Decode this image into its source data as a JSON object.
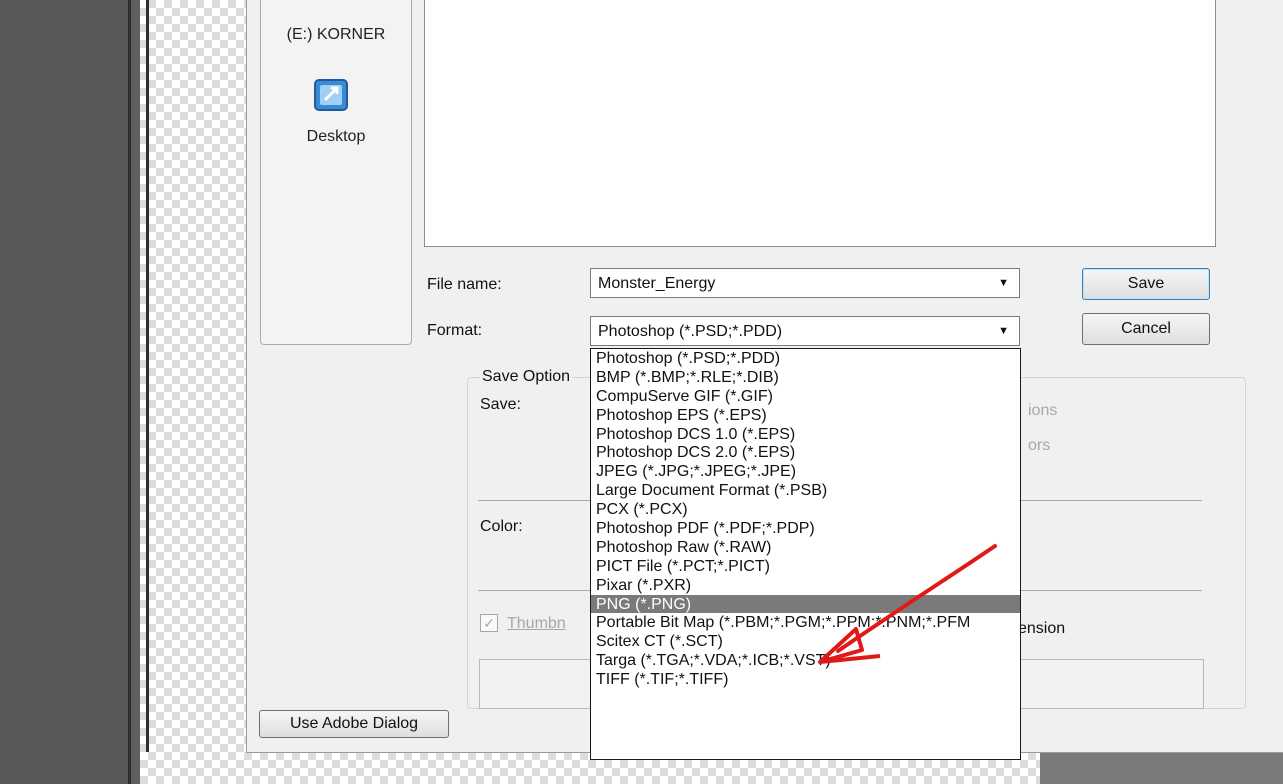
{
  "places": {
    "drive_label": "(E:) KORNER",
    "desktop_label": "Desktop"
  },
  "file_name": {
    "label": "File name:",
    "value": "Monster_Energy"
  },
  "format": {
    "label": "Format:",
    "value": "Photoshop (*.PSD;*.PDD)",
    "options": [
      "Photoshop (*.PSD;*.PDD)",
      "BMP (*.BMP;*.RLE;*.DIB)",
      "CompuServe GIF (*.GIF)",
      "Photoshop EPS (*.EPS)",
      "Photoshop DCS 1.0 (*.EPS)",
      "Photoshop DCS 2.0 (*.EPS)",
      "JPEG (*.JPG;*.JPEG;*.JPE)",
      "Large Document Format (*.PSB)",
      "PCX (*.PCX)",
      "Photoshop PDF (*.PDF;*.PDP)",
      "Photoshop Raw (*.RAW)",
      "PICT File (*.PCT;*.PICT)",
      "Pixar (*.PXR)",
      "PNG (*.PNG)",
      "Portable Bit Map (*.PBM;*.PGM;*.PPM;*.PNM;*.PFM",
      "Scitex CT (*.SCT)",
      "Targa (*.TGA;*.VDA;*.ICB;*.VST)",
      "TIFF (*.TIF;*.TIFF)"
    ],
    "highlighted_option": "PNG (*.PNG)"
  },
  "buttons": {
    "save": "Save",
    "cancel": "Cancel",
    "use_adobe_dialog": "Use Adobe Dialog"
  },
  "save_options": {
    "title": "Save Option",
    "save_label": "Save:",
    "color_label": "Color:",
    "thumbnail_label": "Thumbn",
    "partial_text_1": "ions",
    "partial_text_2": "ors",
    "partial_text_3": "ension",
    "thumbnail_checked": true
  },
  "colors": {
    "highlight": "#7a7a7a",
    "arrow": "#e01818",
    "default_button_border": "#3c7fb1"
  }
}
